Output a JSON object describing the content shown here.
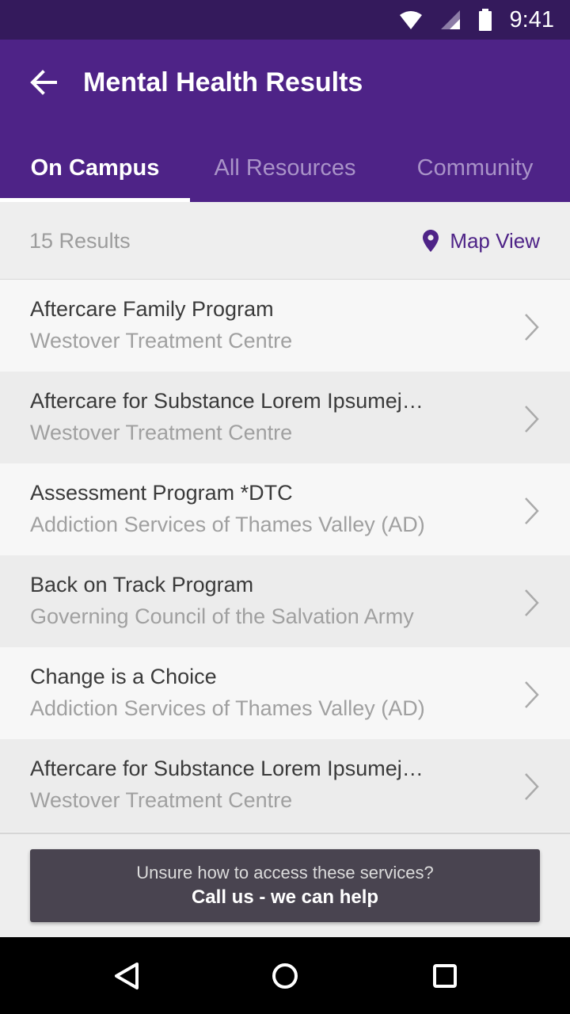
{
  "status_bar": {
    "time": "9:41",
    "icons": [
      "wifi-icon",
      "signal-icon",
      "battery-icon"
    ]
  },
  "header": {
    "title": "Mental Health Results",
    "back_icon": "back-arrow-icon"
  },
  "tabs": [
    {
      "label": "On Campus",
      "active": true
    },
    {
      "label": "All Resources",
      "active": false
    },
    {
      "label": "Community",
      "active": false
    }
  ],
  "results": {
    "count_label": "15 Results",
    "map_view_label": "Map View",
    "map_icon": "map-pin-icon"
  },
  "items": [
    {
      "title": "Aftercare Family Program",
      "subtitle": "Westover Treatment Centre"
    },
    {
      "title": "Aftercare for Substance Lorem Ipsumej…",
      "subtitle": "Westover Treatment Centre"
    },
    {
      "title": "Assessment Program *DTC",
      "subtitle": "Addiction Services of Thames Valley (AD)"
    },
    {
      "title": "Back on Track Program",
      "subtitle": "Governing Council of the Salvation Army"
    },
    {
      "title": "Change is a Choice",
      "subtitle": "Addiction Services of Thames Valley (AD)"
    },
    {
      "title": "Aftercare for Substance Lorem Ipsumej…",
      "subtitle": "Westover Treatment Centre"
    }
  ],
  "help_banner": {
    "line1": "Unsure how to access these services?",
    "line2": "Call us - we can help"
  },
  "colors": {
    "primary": "#4e2387",
    "status_bar": "#341a5c",
    "tab_inactive": "#a993c8",
    "banner": "#494450"
  },
  "nav": {
    "back": "nav-back-icon",
    "home": "nav-home-icon",
    "recents": "nav-recents-icon"
  }
}
